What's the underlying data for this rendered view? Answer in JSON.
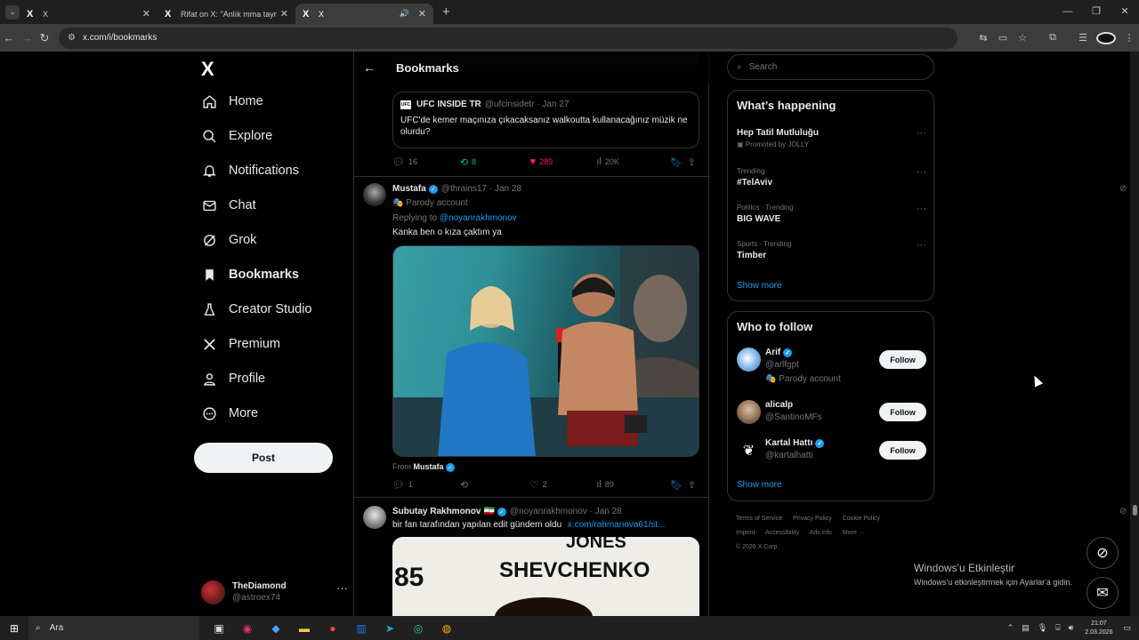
{
  "browser": {
    "tabs": [
      {
        "label": "X",
        "favicon": "X"
      },
      {
        "label": "Rifat on X: \"Anlık mma taymı hi...",
        "favicon": "X"
      },
      {
        "label": "X",
        "favicon": "X"
      }
    ],
    "url": "x.com/i/bookmarks",
    "new_tab": "+"
  },
  "nav": {
    "logo": "X",
    "items": [
      {
        "label": "Home",
        "icon": "home-icon"
      },
      {
        "label": "Explore",
        "icon": "search-icon"
      },
      {
        "label": "Notifications",
        "icon": "bell-icon"
      },
      {
        "label": "Chat",
        "icon": "mail-icon"
      },
      {
        "label": "Grok",
        "icon": "grok-icon"
      },
      {
        "label": "Bookmarks",
        "icon": "bookmark-icon"
      },
      {
        "label": "Creator Studio",
        "icon": "flask-icon"
      },
      {
        "label": "Premium",
        "icon": "x-icon"
      },
      {
        "label": "Profile",
        "icon": "person-icon"
      },
      {
        "label": "More",
        "icon": "more-icon"
      }
    ],
    "post_label": "Post",
    "account": {
      "name": "TheDiamond",
      "handle": "@astroex74"
    }
  },
  "header": {
    "title": "Bookmarks"
  },
  "quote": {
    "name": "UFC INSIDE TR",
    "handle": "@ufcinsidetr",
    "date": "Jan 27",
    "text": "UFC'de kemer maçınıza çıkacaksanız walkoutta kullanacağınız müzik ne olurdu?"
  },
  "tweet1_actions": {
    "replies": "16",
    "reposts": "8",
    "likes": "289",
    "views": "20K"
  },
  "tweet2": {
    "name": "Mustafa",
    "handle": "@thrains17",
    "date": "Jan 28",
    "parody": "Parody account",
    "replying_prefix": "Replying to",
    "replying_to": "@noyanrakhmonov",
    "text": "Kanka ben o kıza çaktım ya",
    "from_label": "From",
    "from_name": "Mustafa",
    "actions": {
      "replies": "1",
      "reposts": "",
      "likes": "2",
      "views": "89"
    }
  },
  "tweet3": {
    "name": "Subutay Rakhmonov",
    "flag": "🇮🇷",
    "handle": "@noyanrakhmonov",
    "date": "Jan 28",
    "text": "bir fan tarafından yapılan edit gündem oldu",
    "link": "x.com/rahmanova61/st...",
    "media_text_1": "JONES",
    "media_text_2": "85",
    "media_text_3": "SHEVCHENKO"
  },
  "search": {
    "placeholder": "Search"
  },
  "trends": {
    "title": "What’s happening",
    "items": [
      {
        "meta": "",
        "title": "Hep Tatil Mutluluğu",
        "promo": "Promoted by JOLLY"
      },
      {
        "meta": "Trending",
        "title": "#TelAviv"
      },
      {
        "meta": "Politics · Trending",
        "title": "BIG WAVE"
      },
      {
        "meta": "Sports · Trending",
        "title": "Timber"
      }
    ],
    "show_more": "Show more"
  },
  "who_to_follow": {
    "title": "Who to follow",
    "people": [
      {
        "name": "Arif",
        "handle": "@arlfgpt",
        "note": "Parody account",
        "verified": true
      },
      {
        "name": "alicalp",
        "handle": "@SantinoMFs",
        "note": "",
        "verified": false
      },
      {
        "name": "Kartal Hattı",
        "handle": "@kartalhatti",
        "note": "",
        "verified": true
      }
    ],
    "follow_label": "Follow",
    "show_more": "Show more"
  },
  "footer": {
    "links": [
      "Terms of Service",
      "Privacy Policy",
      "Cookie Policy",
      "Imprint",
      "Accessibility",
      "Ads info",
      "More ···"
    ],
    "copyright": "© 2026 X Corp."
  },
  "watermark": {
    "line1": "Windows'u Etkinleştir",
    "line2": "Windows'u etkinleştirmek için Ayarlar'a gidin."
  },
  "taskbar": {
    "search": "Ara",
    "time": "21:07",
    "date": "2.03.2026"
  },
  "colors": {
    "accent": "#1d9bf0",
    "like": "#f91880",
    "repost": "#00ba7c"
  }
}
